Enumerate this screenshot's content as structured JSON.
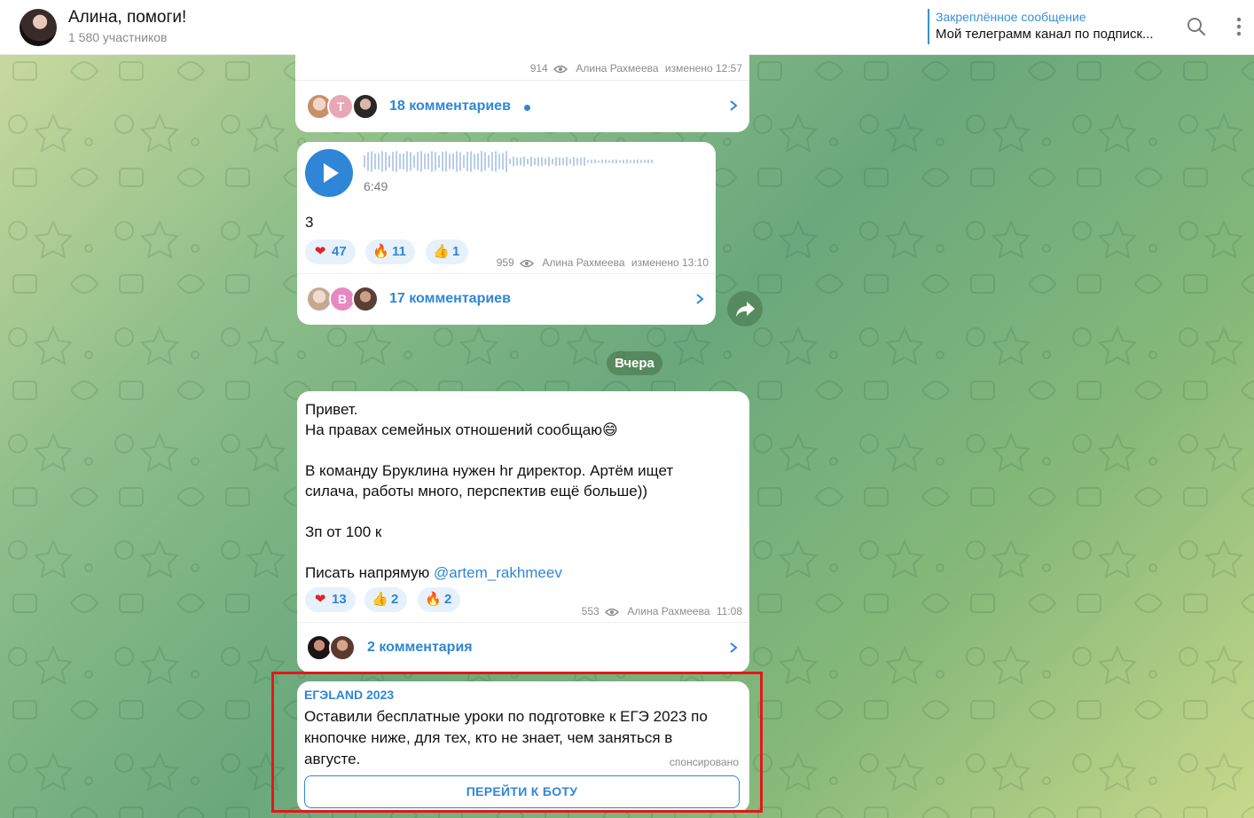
{
  "header": {
    "title": "Алина, помоги!",
    "subtitle": "1 580 участников",
    "pinned_title": "Закреплённое сообщение",
    "pinned_text": "Мой телеграмм канал по подписк..."
  },
  "messages": [
    {
      "meta_views": "914",
      "meta_author": "Алина Рахмеева",
      "meta_time": "изменено 12:57",
      "comments": "18 комментариев",
      "comment_avatar_letters": [
        "",
        "T",
        ""
      ]
    },
    {
      "voice_duration": "6:49",
      "text": "3",
      "reactions": [
        {
          "emoji": "❤",
          "count": "47"
        },
        {
          "emoji": "🔥",
          "count": "11"
        },
        {
          "emoji": "👍",
          "count": "1"
        }
      ],
      "meta_views": "959",
      "meta_author": "Алина Рахмеева",
      "meta_time": "изменено 13:10",
      "comments": "17 комментариев",
      "comment_avatar_letters": [
        "",
        "B",
        ""
      ]
    },
    {
      "lines": [
        "Привет.",
        "На правах семейных отношений сообщаю😄",
        "",
        "В команду Бруклина нужен hr директор. Артём ищет",
        "силача, работы много, перспектив ещё больше))",
        "",
        "Зп от 100 к",
        ""
      ],
      "write_prefix": "Писать напрямую ",
      "mention": "@artem_rakhmeev",
      "reactions": [
        {
          "emoji": "❤",
          "count": "13"
        },
        {
          "emoji": "👍",
          "count": "2"
        },
        {
          "emoji": "🔥",
          "count": "2"
        }
      ],
      "meta_views": "553",
      "meta_author": "Алина Рахмеева",
      "meta_time": "11:08",
      "comments": "2 комментария"
    }
  ],
  "date_separator": "Вчера",
  "ad": {
    "sponsor": "ЕГЭLAND 2023",
    "text_lines": [
      "Оставили бесплатные уроки по подготовке к ЕГЭ 2023 по",
      "кнопочке ниже, для тех, кто не знает, чем заняться в",
      "августе."
    ],
    "sponsored_label": "спонсировано",
    "button_label": "ПЕРЕЙТИ К БОТУ"
  },
  "colors": {
    "accent": "#2f86d6",
    "highlight": "#e0191b"
  }
}
